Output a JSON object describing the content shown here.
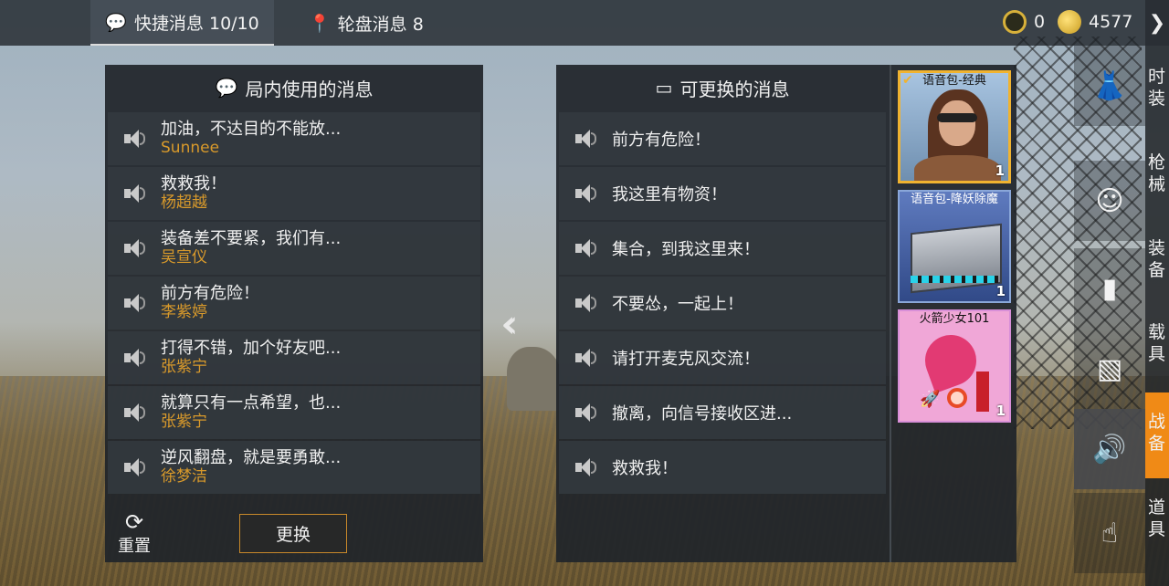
{
  "topbar": {
    "tab_quick": "快捷消息 10/10",
    "tab_wheel": "轮盘消息 8",
    "bp_amount": "0",
    "uc_amount": "4577",
    "close_glyph": "❯"
  },
  "left_panel": {
    "title": "局内使用的消息",
    "messages": [
      {
        "text": "加油，不达目的不能放...",
        "author": "Sunnee"
      },
      {
        "text": "救救我！",
        "author": "杨超越"
      },
      {
        "text": "装备差不要紧，我们有...",
        "author": "吴宣仪"
      },
      {
        "text": "前方有危险！",
        "author": "李紫婷"
      },
      {
        "text": "打得不错，加个好友吧...",
        "author": "张紫宁"
      },
      {
        "text": "就算只有一点希望，也...",
        "author": "张紫宁"
      },
      {
        "text": "逆风翻盘，就是要勇敢...",
        "author": "徐梦洁"
      }
    ],
    "reset_label": "重置",
    "swap_label": "更换"
  },
  "right_panel": {
    "title": "可更换的消息",
    "messages": [
      {
        "text": "前方有危险！"
      },
      {
        "text": "我这里有物资！"
      },
      {
        "text": "集合，到我这里来！"
      },
      {
        "text": "不要怂，一起上！"
      },
      {
        "text": "请打开麦克风交流！"
      },
      {
        "text": "撤离，向信号接收区进..."
      },
      {
        "text": "救救我！"
      }
    ]
  },
  "voice_packs": [
    {
      "label": "语音包-经典",
      "count": "1",
      "selected": true
    },
    {
      "label": "语音包-降妖除魔",
      "count": "1",
      "selected": false
    },
    {
      "label": "火箭少女101",
      "count": "1",
      "selected": false
    }
  ],
  "sidebar": {
    "icons": [
      "dress-icon",
      "sticker-icon",
      "spray-icon",
      "photo-icon",
      "speaker-icon",
      "gesture-icon"
    ],
    "tabs": [
      "时装",
      "枪械",
      "装备",
      "载具",
      "战备",
      "道具"
    ],
    "active_tab": "战备"
  },
  "colors": {
    "accent": "#f08a16",
    "author": "#d99a2b",
    "selected_border": "#f0b330"
  }
}
